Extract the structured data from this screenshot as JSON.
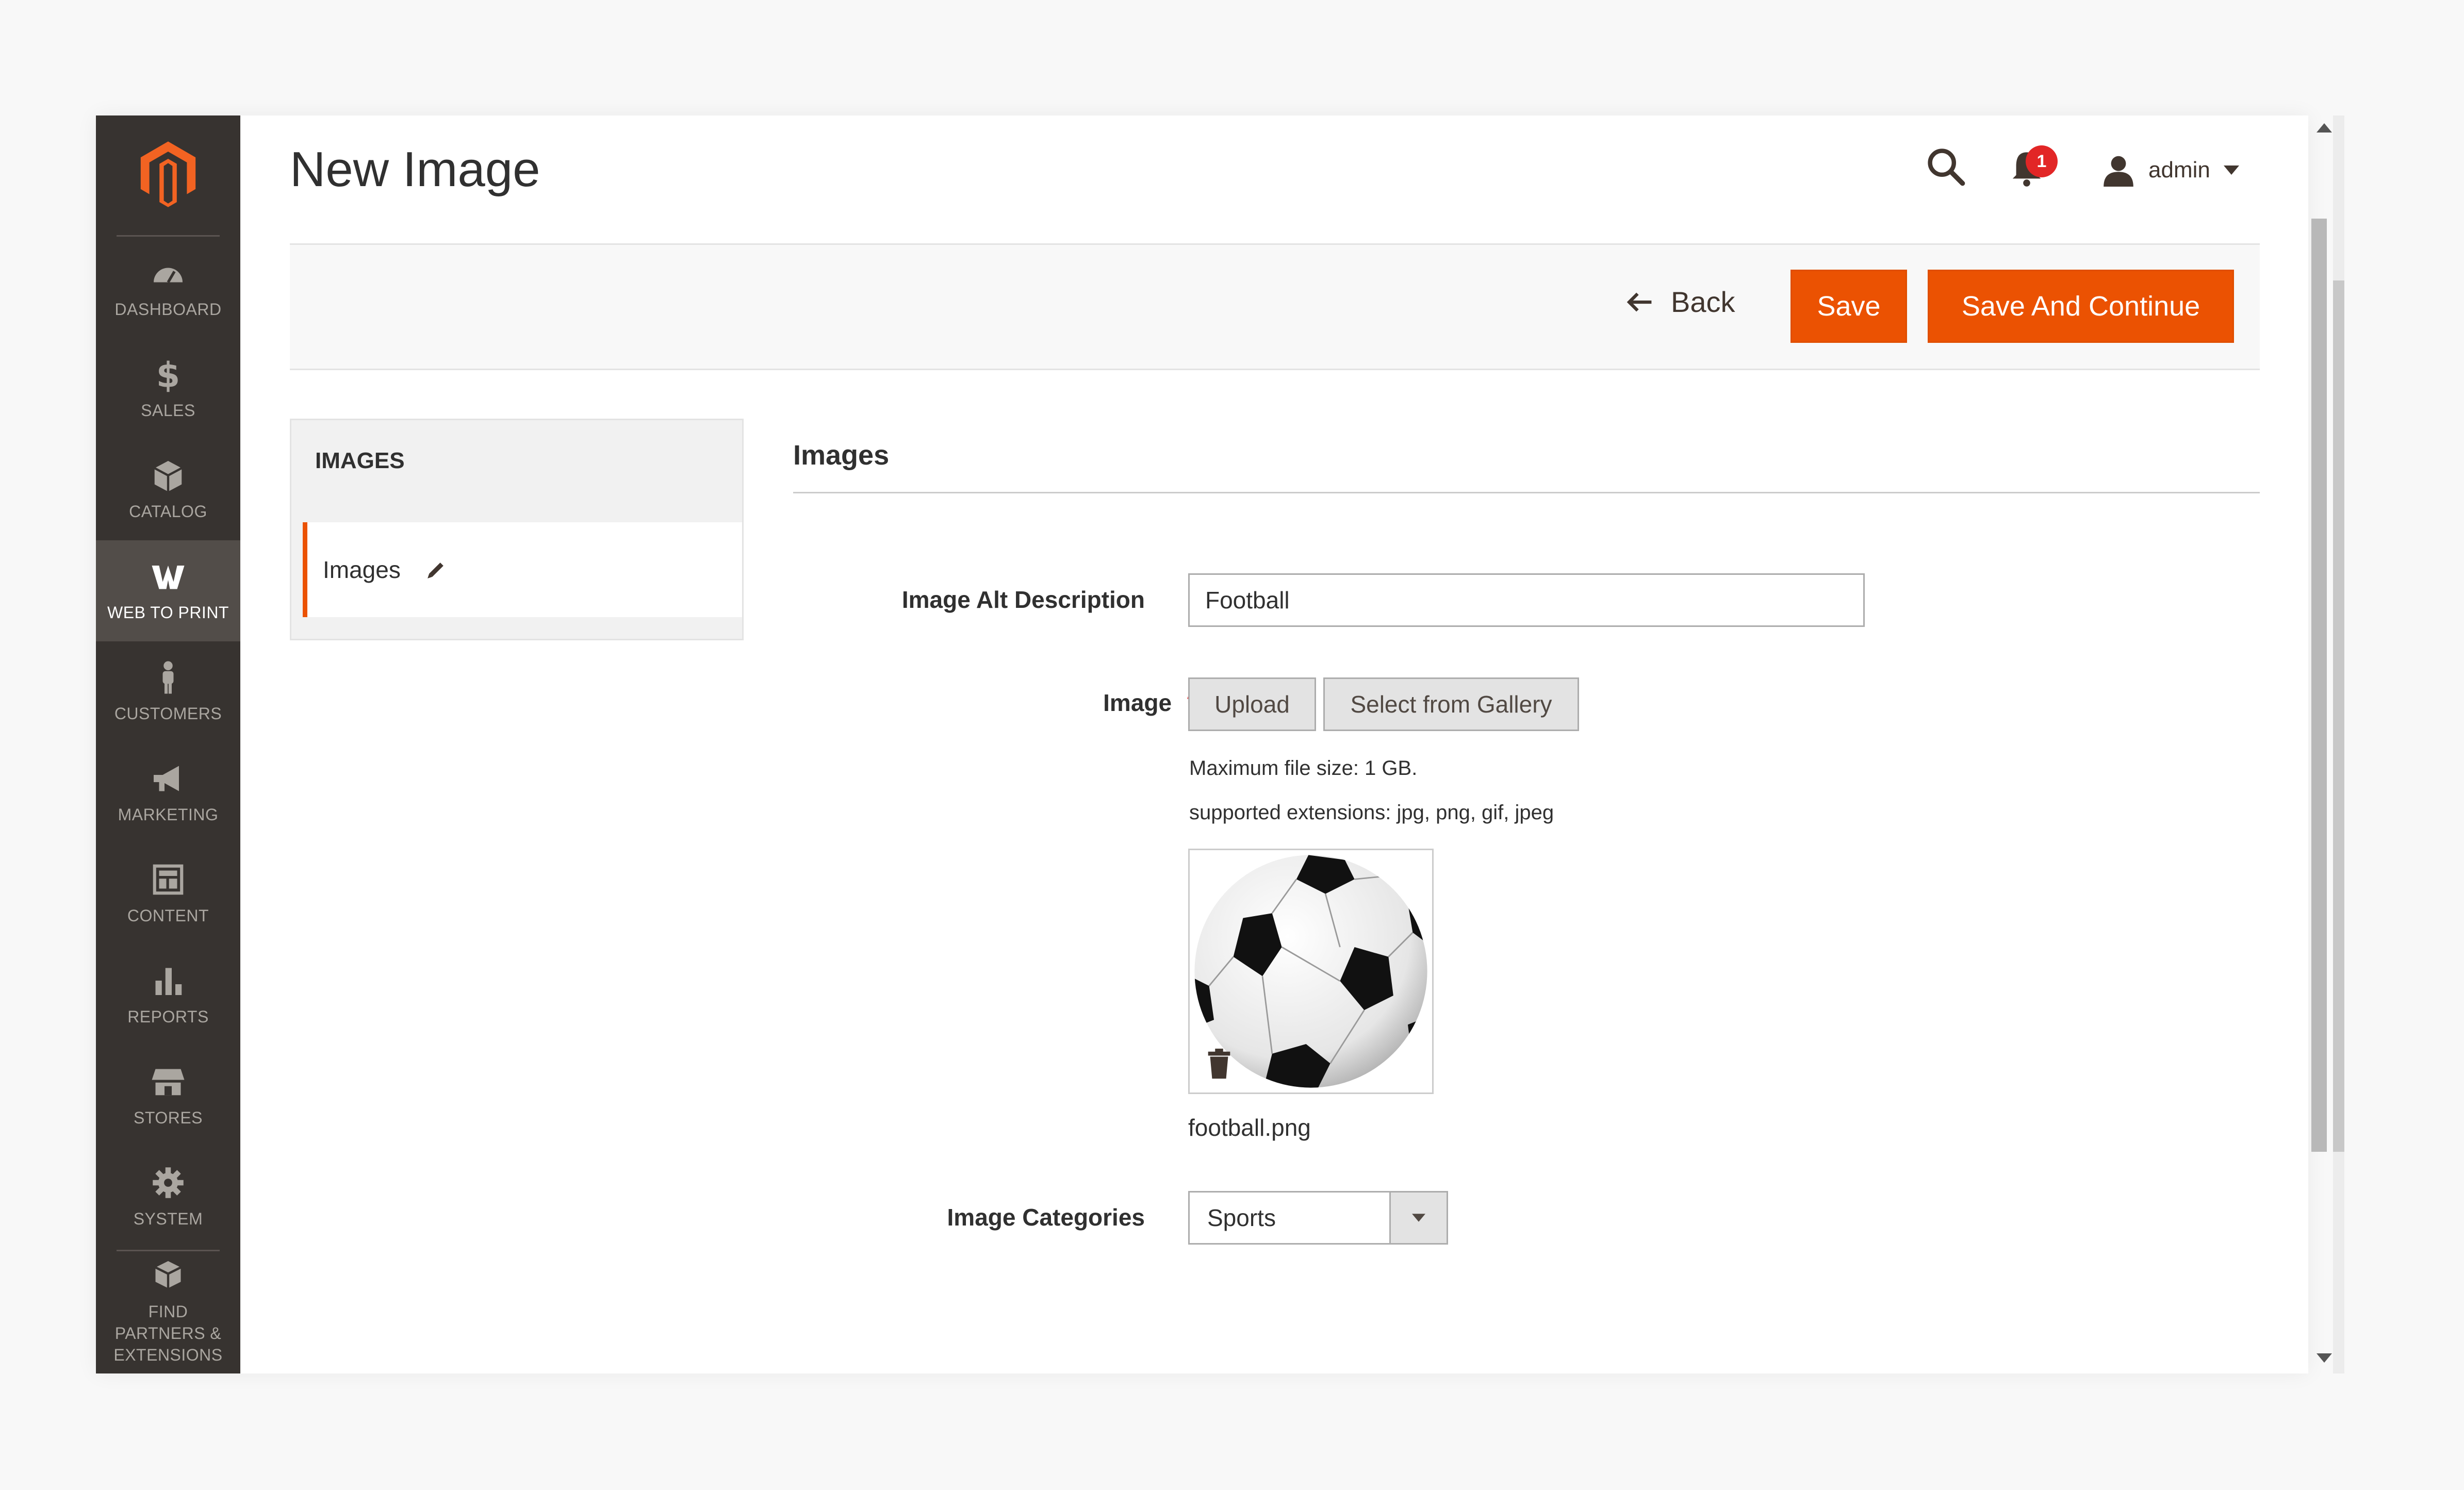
{
  "sidebar": {
    "items": [
      {
        "label": "Dashboard",
        "icon": "dashboard-gauge-icon"
      },
      {
        "label": "Sales",
        "icon": "dollar-icon"
      },
      {
        "label": "Catalog",
        "icon": "box-icon"
      },
      {
        "label": "Web to Print",
        "icon": "w2p-icon",
        "active": true
      },
      {
        "label": "Customers",
        "icon": "person-icon"
      },
      {
        "label": "Marketing",
        "icon": "megaphone-icon"
      },
      {
        "label": "Content",
        "icon": "layout-icon"
      },
      {
        "label": "Reports",
        "icon": "bar-chart-icon"
      },
      {
        "label": "Stores",
        "icon": "storefront-icon"
      },
      {
        "label": "System",
        "icon": "gear-icon"
      },
      {
        "label": "Find Partners & Extensions",
        "icon": "cubes-icon"
      }
    ]
  },
  "header": {
    "title": "New Image",
    "notifications": "1",
    "user": "admin"
  },
  "actions": {
    "back": "Back",
    "save": "Save",
    "save_continue": "Save And Continue"
  },
  "tabs": {
    "heading": "IMAGES",
    "item": "Images"
  },
  "form": {
    "section": "Images",
    "alt_label": "Image Alt Description",
    "alt_value": "Football",
    "image_label": "Image",
    "required_mark": "*",
    "upload": "Upload",
    "gallery": "Select from Gallery",
    "max_size": "Maximum file size: 1 GB.",
    "extensions": "supported extensions: jpg, png, gif, jpeg",
    "filename": "football.png",
    "categories_label": "Image Categories",
    "categories_value": "Sports"
  },
  "colors": {
    "sidebar_bg": "#373330",
    "accent": "#eb5202",
    "badge": "#e22626"
  }
}
